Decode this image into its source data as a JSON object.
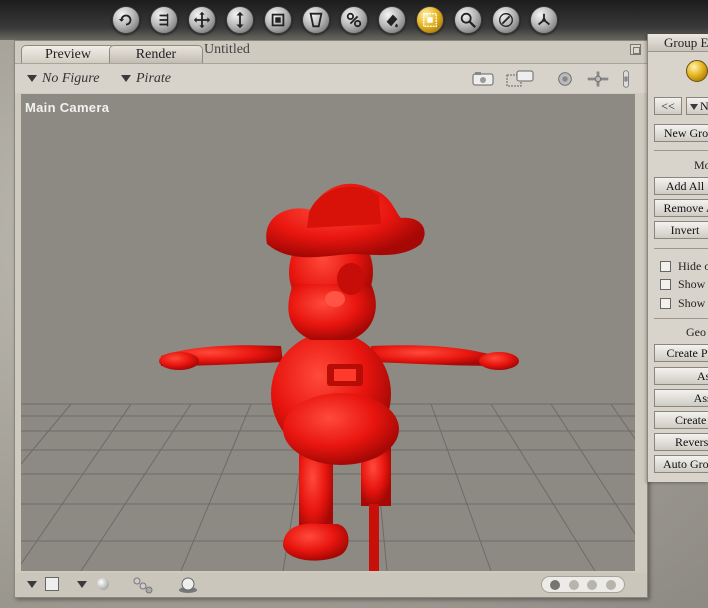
{
  "toolbar": {
    "tools": [
      {
        "name": "rotate-tool-icon",
        "active": false
      },
      {
        "name": "twist-tool-icon",
        "active": false
      },
      {
        "name": "translate-tool-icon",
        "active": false
      },
      {
        "name": "translate-in-out-icon",
        "active": false
      },
      {
        "name": "scale-tool-icon",
        "active": false
      },
      {
        "name": "taper-tool-icon",
        "active": false
      },
      {
        "name": "chain-break-icon",
        "active": false
      },
      {
        "name": "color-tool-icon",
        "active": false
      },
      {
        "name": "grouping-tool-icon",
        "active": true
      },
      {
        "name": "view-magnifier-icon",
        "active": false
      },
      {
        "name": "morph-brush-icon",
        "active": false
      },
      {
        "name": "direct-manipulation-icon",
        "active": false
      }
    ]
  },
  "document": {
    "tabs": {
      "preview": "Preview",
      "render": "Render",
      "untitled": "Untitled"
    },
    "figure_menu": "No Figure",
    "actor_menu": "Pirate",
    "camera_label": "Main Camera"
  },
  "group_panel": {
    "title": "Group E",
    "prev_button": "<<",
    "group_select": "N",
    "new_group": "New Grou",
    "modify_heading": "Mo",
    "add_all": "Add All",
    "remove_all": "Remove A",
    "invert": "Invert",
    "hide_label": "Hide o",
    "show_label_1": "Show",
    "show_label_2": "Show",
    "geometry_heading": "Geo",
    "create_prop": "Create Pr",
    "assign_1": "Ass",
    "assign_2": "Assig",
    "create": "Create",
    "reverse": "Revers",
    "auto_group": "Auto Gro"
  },
  "colors": {
    "figure": "#e8150f",
    "viewport_bg": "#8d8a84",
    "active_tool": "#e6b421"
  }
}
